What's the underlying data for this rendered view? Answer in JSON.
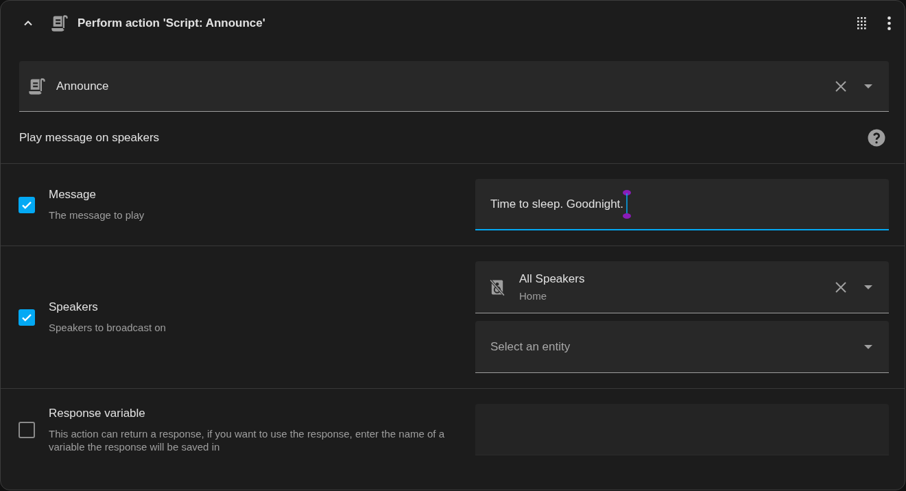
{
  "header": {
    "title": "Perform action 'Script: Announce'",
    "expanded": true
  },
  "service": {
    "value": "Announce"
  },
  "description": "Play message on speakers",
  "fields": [
    {
      "kind": "text",
      "name": "Message",
      "description": "The message to play",
      "checked": true,
      "focused": true,
      "value": "Time to sleep. Goodnight."
    },
    {
      "kind": "entity",
      "name": "Speakers",
      "description": "Speakers to broadcast on",
      "checked": true,
      "entities": [
        {
          "name": "All Speakers",
          "area": "Home"
        }
      ],
      "placeholder": "Select an entity"
    },
    {
      "kind": "text",
      "name": "Response variable",
      "description": "This action can return a response, if you want to use the response, enter the name of a variable the response will be saved in",
      "checked": false,
      "focused": false
    }
  ]
}
